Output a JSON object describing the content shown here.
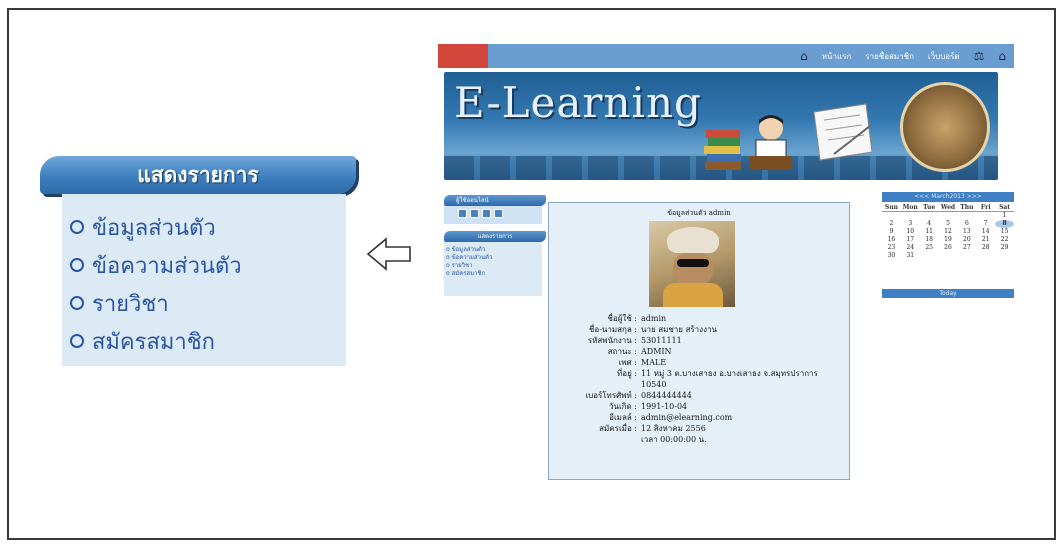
{
  "callout": {
    "title": "แสดงรายการ",
    "items": [
      "ข้อมูลส่วนตัว",
      "ข้อความส่วนตัว",
      "รายวิชา",
      "สมัครสมาชิก"
    ]
  },
  "site": {
    "nav": {
      "home_icon": "house-icon",
      "item1": "หน้าแรก",
      "item2": "รายชื่อสมาชิก",
      "item3": "เว็บบอร์ด",
      "icons": [
        "scale-icon",
        "building-icon"
      ]
    },
    "banner_title": "E-Learning",
    "login_head": "ผู้ใช้ออนไลน์",
    "menu_head": "แสดงรายการ",
    "menu_items": [
      "ข้อมูลส่วนตัว",
      "ข้อความส่วนตัว",
      "รายวิชา",
      "สมัครสมาชิก"
    ]
  },
  "profile": {
    "title": "ข้อมูลส่วนตัว admin",
    "fields": [
      {
        "k": "ชื่อผู้ใช้ :",
        "v": "admin"
      },
      {
        "k": "ชื่อ-นามสกุล :",
        "v": "นาย สมชาย สร้างงาน"
      },
      {
        "k": "รหัสพนักงาน :",
        "v": "53011111"
      },
      {
        "k": "สถานะ :",
        "v": "ADMIN"
      },
      {
        "k": "เพศ :",
        "v": "MALE"
      },
      {
        "k": "ที่อยู่ :",
        "v": "11 หมู่ 3 ต.บางเสาธง อ.บางเสาธง จ.สมุทรปราการ 10540"
      },
      {
        "k": "เบอร์โทรศัพท์ :",
        "v": "0844444444"
      },
      {
        "k": "วันเกิด :",
        "v": "1991-10-04"
      },
      {
        "k": "อีเมลล์ :",
        "v": "admin@elearning.com"
      },
      {
        "k": "สมัครเมื่อ :",
        "v": "12 สิงหาคม 2556"
      },
      {
        "k": "",
        "v": "เวลา 00:00:00 น."
      }
    ]
  },
  "calendar": {
    "title": "<<< March2013 >>>",
    "dow": [
      "Sun",
      "Mon",
      "Tue",
      "Wed",
      "Thu",
      "Fri",
      "Sat"
    ],
    "days": [
      "",
      "",
      "",
      "",
      "",
      "",
      "1",
      "2",
      "3",
      "4",
      "5",
      "6",
      "7",
      "8",
      "9",
      "10",
      "11",
      "12",
      "13",
      "14",
      "15",
      "16",
      "17",
      "18",
      "19",
      "20",
      "21",
      "22",
      "23",
      "24",
      "25",
      "26",
      "27",
      "28",
      "29",
      "30",
      "31"
    ],
    "today": "8",
    "footer": "Today"
  }
}
